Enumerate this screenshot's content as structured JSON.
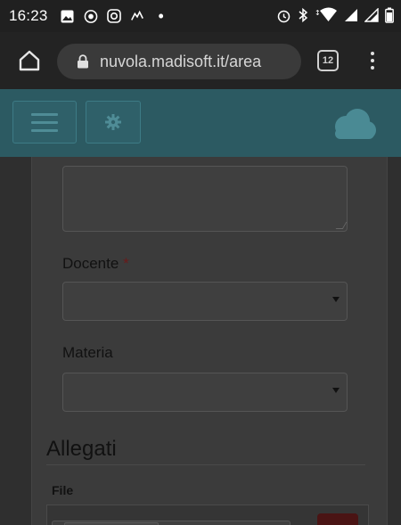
{
  "status_bar": {
    "time": "16:23",
    "left_icons": [
      "gallery-icon",
      "whatsapp-icon",
      "instagram-icon",
      "messenger-icon"
    ],
    "right_icons": [
      "alarm-icon",
      "bluetooth-icon",
      "wifi-icon",
      "signal-icon",
      "signal-icon",
      "battery-icon"
    ]
  },
  "browser": {
    "url": "nuvola.madisoft.it/area",
    "tab_count": "12"
  },
  "form": {
    "docente_label": "Docente",
    "required_mark": "*",
    "materia_label": "Materia",
    "allegati_title": "Allegati",
    "file_label": "File"
  },
  "colors": {
    "header_teal": "#2c5a62",
    "required_red": "#6a1a1a",
    "remove_button_red": "#4a1414"
  }
}
